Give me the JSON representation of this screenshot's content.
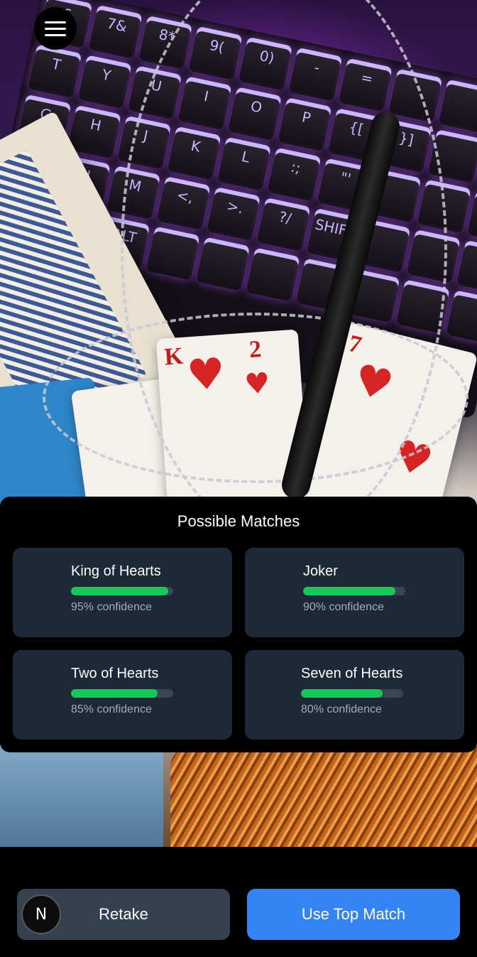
{
  "menu": {
    "icon": "hamburger-menu-icon"
  },
  "matches": {
    "title": "Possible Matches",
    "items": [
      {
        "name": "King of Hearts",
        "confidence": 0.95,
        "confidence_text": "95% confidence"
      },
      {
        "name": "Joker",
        "confidence": 0.9,
        "confidence_text": "90% confidence"
      },
      {
        "name": "Two of Hearts",
        "confidence": 0.85,
        "confidence_text": "85% confidence"
      },
      {
        "name": "Seven of Hearts",
        "confidence": 0.8,
        "confidence_text": "80% confidence"
      }
    ]
  },
  "actions": {
    "retake_label": "Retake",
    "use_top_label": "Use Top Match",
    "badge_letter": "N"
  },
  "colors": {
    "panel_bg": "#000000",
    "card_bg": "#1e2938",
    "confidence_fill": "#16c75a",
    "primary_button": "#3584f6",
    "secondary_button": "#354050"
  }
}
